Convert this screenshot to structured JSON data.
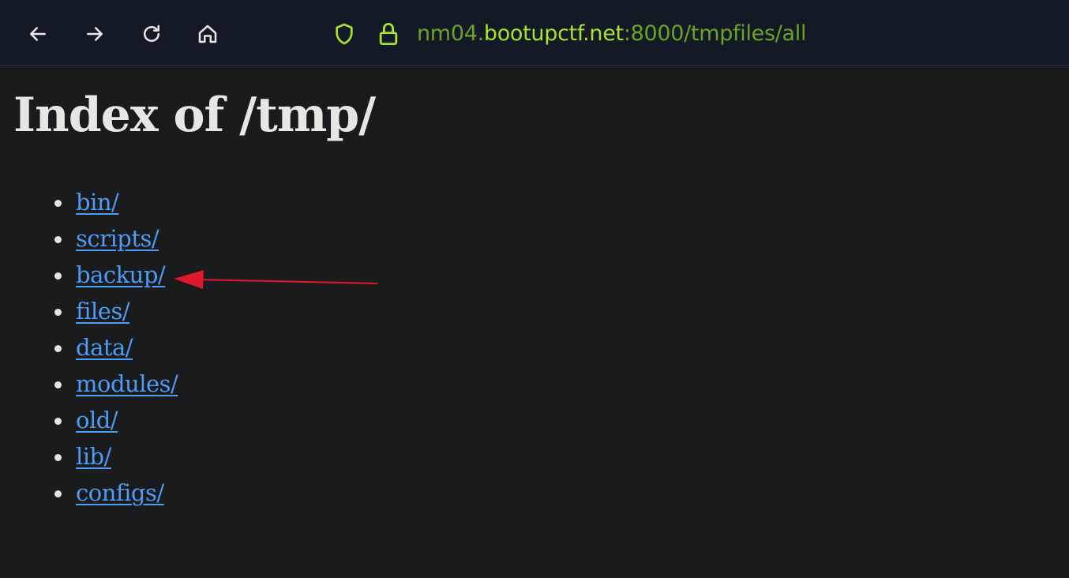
{
  "browser": {
    "url_prefix": "nm04.",
    "url_domain": "bootupctf.net",
    "url_suffix": ":8000/tmpfiles/all",
    "accent_color": "#a6e22e"
  },
  "page": {
    "title": "Index of /tmp/",
    "entries": [
      "bin/",
      "scripts/",
      "backup/",
      "files/",
      "data/",
      "modules/",
      "old/",
      "lib/",
      "configs/"
    ],
    "link_color": "#4e9cf5"
  },
  "annotation": {
    "arrow_color": "#e0182d",
    "points_to": "backup/"
  }
}
